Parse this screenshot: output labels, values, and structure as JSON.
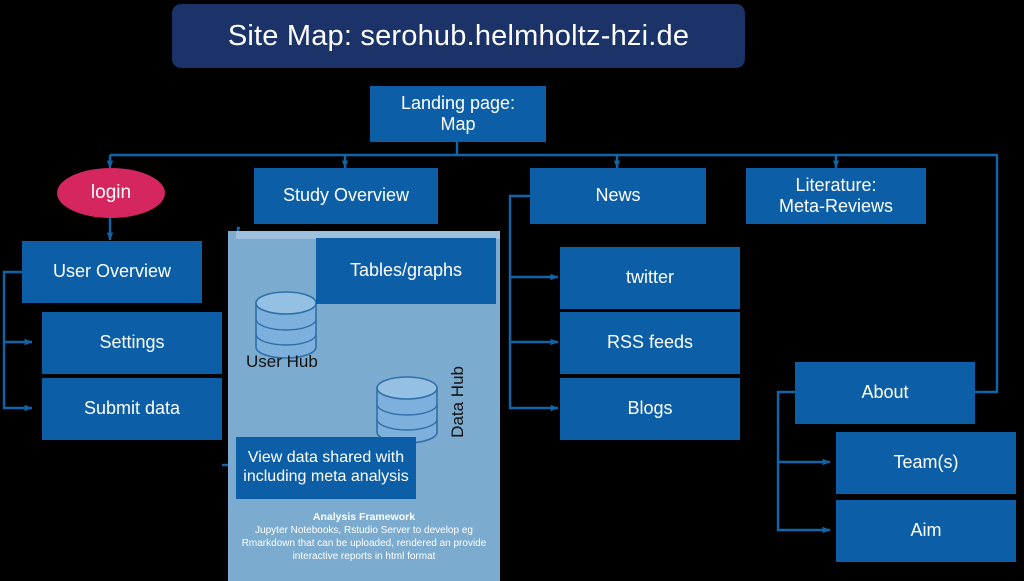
{
  "title": {
    "text": "Site Map: serohub.helmholtz-hzi.de"
  },
  "nodes": {
    "landing": "Landing page:\nMap",
    "login": "login",
    "user_overview": "User Overview",
    "settings": "Settings",
    "submit_data": "Submit data",
    "study_overview": "Study Overview",
    "tables_graphs": "Tables/graphs",
    "view_data": "View data shared with including meta analysis",
    "news": "News",
    "twitter": "twitter",
    "rss_feeds": "RSS feeds",
    "blogs": "Blogs",
    "literature": "Literature:\nMeta-Reviews",
    "about": "About",
    "teams": "Team(s)",
    "aim": "Aim"
  },
  "hub": {
    "user_hub_label": "User Hub",
    "data_hub_label": "Data Hub"
  },
  "framework": {
    "heading": "Analysis Framework",
    "line1": "Jupyter Notebooks, Rstudio Server to  develop eg",
    "line2": "Rmarkdown that can be uploaded, rendered an provide",
    "line3": "interactive reports in html format"
  },
  "colors": {
    "background": "#000000",
    "title_banner": "#1b3368",
    "node_fill": "#0c5ea7",
    "login_fill": "#d5265f",
    "hub_panel": "#7cabd0",
    "connector": "#1064a8",
    "text_light": "#ffffff",
    "text_dark": "#111111"
  }
}
